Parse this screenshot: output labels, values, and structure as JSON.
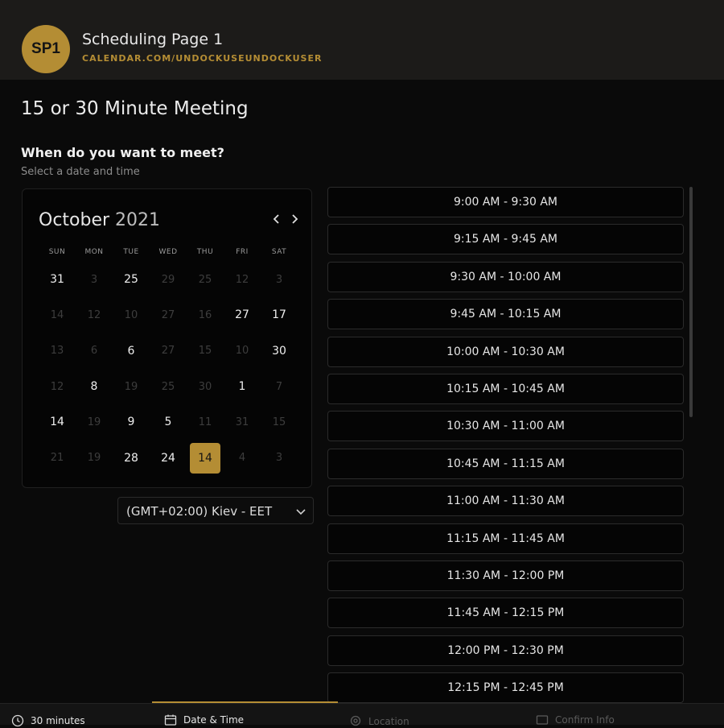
{
  "header": {
    "avatar_initials": "SP1",
    "page_name": "Scheduling Page 1",
    "url": "CALENDAR.COM/UNDOCKUSEUNDOCKUSER"
  },
  "main": {
    "title": "15 or 30 Minute Meeting",
    "question": "When do you want to meet?",
    "hint": "Select a date and time"
  },
  "calendar": {
    "month": "October",
    "year": "2021",
    "weekdays": [
      "SUN",
      "MON",
      "TUE",
      "WED",
      "THU",
      "FRI",
      "SAT"
    ],
    "weeks": [
      [
        {
          "d": "31",
          "s": "active"
        },
        {
          "d": "3",
          "s": "muted"
        },
        {
          "d": "25",
          "s": "active"
        },
        {
          "d": "29",
          "s": "muted"
        },
        {
          "d": "25",
          "s": "muted"
        },
        {
          "d": "12",
          "s": "muted"
        },
        {
          "d": "3",
          "s": "muted"
        }
      ],
      [
        {
          "d": "14",
          "s": "muted"
        },
        {
          "d": "12",
          "s": "muted"
        },
        {
          "d": "10",
          "s": "muted"
        },
        {
          "d": "27",
          "s": "muted"
        },
        {
          "d": "16",
          "s": "muted"
        },
        {
          "d": "27",
          "s": "active"
        },
        {
          "d": "17",
          "s": "active"
        }
      ],
      [
        {
          "d": "13",
          "s": "muted"
        },
        {
          "d": "6",
          "s": "muted"
        },
        {
          "d": "6",
          "s": "active"
        },
        {
          "d": "27",
          "s": "muted"
        },
        {
          "d": "15",
          "s": "muted"
        },
        {
          "d": "10",
          "s": "muted"
        },
        {
          "d": "30",
          "s": "active"
        }
      ],
      [
        {
          "d": "12",
          "s": "muted"
        },
        {
          "d": "8",
          "s": "active"
        },
        {
          "d": "19",
          "s": "muted"
        },
        {
          "d": "25",
          "s": "muted"
        },
        {
          "d": "30",
          "s": "muted"
        },
        {
          "d": "1",
          "s": "active"
        },
        {
          "d": "7",
          "s": "muted"
        }
      ],
      [
        {
          "d": "14",
          "s": "active"
        },
        {
          "d": "19",
          "s": "muted"
        },
        {
          "d": "9",
          "s": "active"
        },
        {
          "d": "5",
          "s": "active"
        },
        {
          "d": "11",
          "s": "muted"
        },
        {
          "d": "31",
          "s": "muted"
        },
        {
          "d": "15",
          "s": "muted"
        }
      ],
      [
        {
          "d": "21",
          "s": "muted"
        },
        {
          "d": "19",
          "s": "muted"
        },
        {
          "d": "28",
          "s": "active"
        },
        {
          "d": "24",
          "s": "active"
        },
        {
          "d": "14",
          "s": "selected"
        },
        {
          "d": "4",
          "s": "muted"
        },
        {
          "d": "3",
          "s": "muted"
        }
      ]
    ]
  },
  "timezone": {
    "value": "(GMT+02:00) Kiev - EET"
  },
  "slots": [
    "9:00 AM - 9:30 AM",
    "9:15 AM - 9:45 AM",
    "9:30 AM - 10:00 AM",
    "9:45 AM - 10:15 AM",
    "10:00 AM - 10:30 AM",
    "10:15 AM - 10:45 AM",
    "10:30 AM - 11:00 AM",
    "10:45 AM - 11:15 AM",
    "11:00 AM - 11:30 AM",
    "11:15 AM - 11:45 AM",
    "11:30 AM - 12:00 PM",
    "11:45 AM - 12:15 PM",
    "12:00 PM - 12:30 PM",
    "12:15 PM - 12:45 PM"
  ],
  "footer": {
    "duration": "30 minutes",
    "step_date_time": "Date & Time",
    "step_location": "Location",
    "step_confirm": "Confirm Info"
  },
  "colors": {
    "accent": "#b48d34",
    "background": "#0a0a0a",
    "header": "#1c1b19"
  },
  "icons": [
    "clock-icon",
    "calendar-icon",
    "location-pin-icon",
    "card-icon",
    "chevron-left-icon",
    "chevron-right-icon",
    "chevron-down-icon"
  ]
}
